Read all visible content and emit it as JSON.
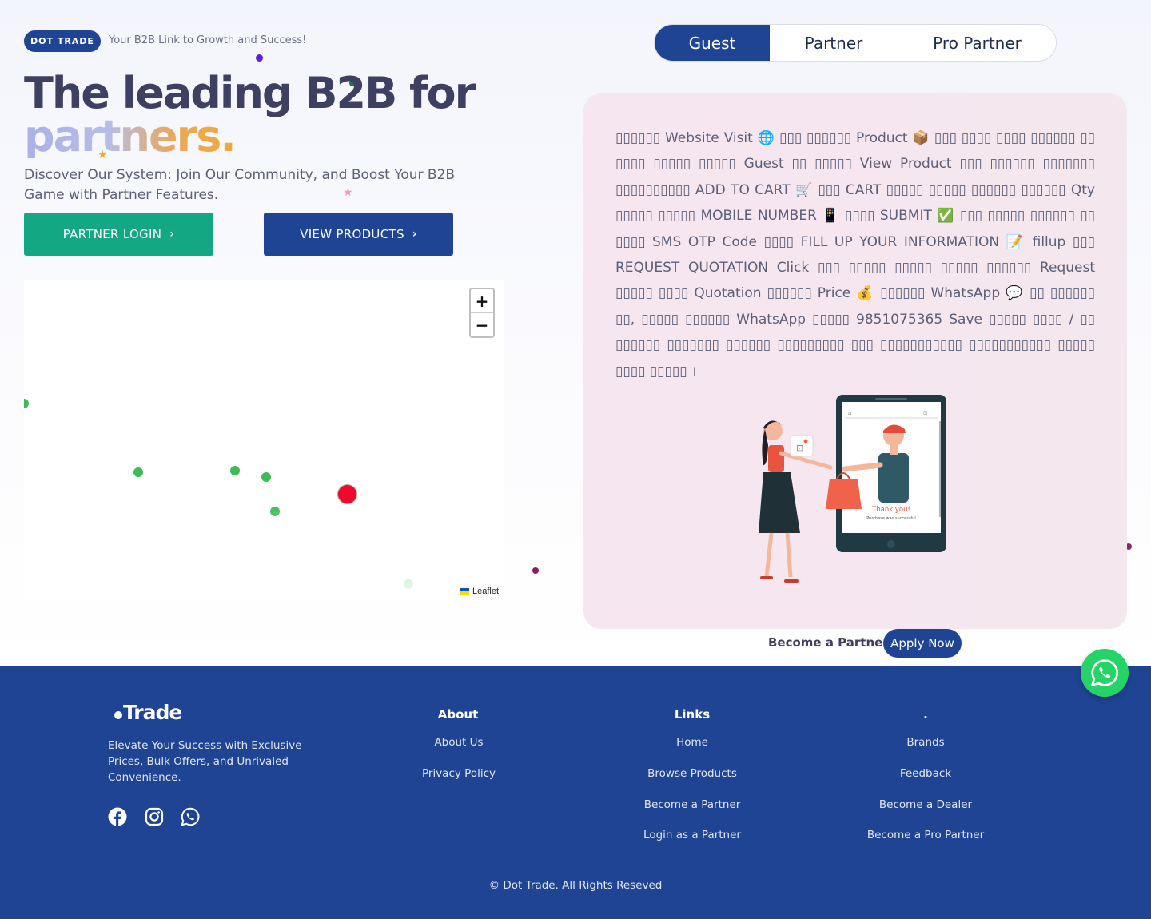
{
  "header": {
    "badge": "DOT TRADE",
    "tagline": "Your B2B Link to Growth and Success!"
  },
  "hero": {
    "headline_main": "The leading B2B for",
    "headline_accent": "partners.",
    "description": "Discover Our System: Join Our Community, and Boost Your B2B Game with Partner Features.",
    "partner_login_label": "PARTNER LOGIN",
    "view_products_label": "VIEW PRODUCTS"
  },
  "map": {
    "zoom_in": "+",
    "zoom_out": "−",
    "attribution": "Leaflet"
  },
  "tabs": [
    {
      "label": "Guest",
      "active": true
    },
    {
      "label": "Partner",
      "active": false
    },
    {
      "label": "Pro Partner",
      "active": false
    }
  ],
  "card": {
    "instructions": "▯▯▯▯▯▯ Website Visit 🌐 ▯▯▯ ▯▯▯▯▯▯ Product 📦 ▯▯▯ ▯▯▯▯ ▯▯▯▯ ▯▯▯▯▯▯ ▯▯ ▯▯▯▯ ▯▯▯▯▯ ▯▯▯▯▯ Guest ▯▯ ▯▯▯▯▯ View Product ▯▯▯ ▯▯▯▯▯▯ ▯▯▯▯▯▯▯ ▯▯▯▯▯▯▯▯▯▯ ADD TO CART 🛒 ▯▯▯ CART ▯▯▯▯▯ ▯▯▯▯▯ ▯▯▯▯▯▯ ▯▯▯▯▯▯ Qty ▯▯▯▯▯ ▯▯▯▯▯ MOBILE NUMBER 📱 ▯▯▯▯ SUBMIT ✅ ▯▯▯ ▯▯▯▯▯ ▯▯▯▯▯▯ ▯▯ ▯▯▯▯ SMS OTP Code ▯▯▯▯ FILL UP YOUR INFORMATION 📝 fillup ▯▯▯ REQUEST QUOTATION Click ▯▯▯ ▯▯▯▯▯ ▯▯▯▯▯ ▯▯▯▯▯ ▯▯▯▯▯▯ Request ▯▯▯▯▯ ▯▯▯▯ Quotation ▯▯▯▯▯▯ Price 💰 ▯▯▯▯▯▯ WhatsApp 💬 ▯▯ ▯▯▯▯▯▯ ▯▯, ▯▯▯▯▯ ▯▯▯▯▯▯ WhatsApp ▯▯▯▯▯ 9851075365 Save ▯▯▯▯▯ ▯▯▯▯ / ▯▯ ▯▯▯▯▯▯ ▯▯▯▯▯▯▯ ▯▯▯▯▯▯ ▯▯▯▯▯▯▯▯▯ ▯▯▯ ▯▯▯▯▯▯▯▯▯▯▯ ▯▯▯▯▯▯▯▯▯▯▯ ▯▯▯▯▯ ▯▯▯▯ ▯▯▯▯▯ ।",
    "illustration_thank_you": "Thank you!",
    "illustration_purchase": "Purchase was successful"
  },
  "become_partner": {
    "label": "Become a Partner",
    "button": "Apply Now"
  },
  "footer": {
    "logo": "Trade",
    "description": "Elevate Your Success with Exclusive Prices, Bulk Offers, and Unrivaled Convenience.",
    "social_icons": [
      "facebook-icon",
      "instagram-icon",
      "whatsapp-icon"
    ],
    "columns": [
      {
        "title": "About",
        "links": [
          "About Us",
          "Privacy Policy"
        ]
      },
      {
        "title": "Links",
        "links": [
          "Home",
          "Browse Products",
          "Become a Partner",
          "Login as a Partner"
        ]
      },
      {
        "title": ".",
        "links": [
          "Brands",
          "Feedback",
          "Become a Dealer",
          "Become a Pro Partner"
        ]
      }
    ],
    "copyright": "© Dot Trade. All Rights Reseved"
  },
  "colors": {
    "brand_blue": "#1f4494",
    "brand_green": "#13a883",
    "whatsapp_green": "#25d366",
    "card_pink": "#f6e6f0"
  }
}
